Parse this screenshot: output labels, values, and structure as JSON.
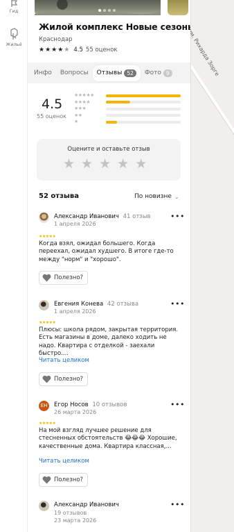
{
  "rail": {
    "items": [
      {
        "label": "Гид"
      },
      {
        "label": "Жильё"
      }
    ]
  },
  "map": {
    "road_label": "им. Рихарда Зорге"
  },
  "place": {
    "title": "Жилой комплекс Новые сезоны",
    "city": "Краснодар",
    "rating": "4.5",
    "ratings_count": "55 оценок"
  },
  "tabs": [
    {
      "label": "Инфо",
      "badge": ""
    },
    {
      "label": "Вопросы",
      "badge": ""
    },
    {
      "label": "Отзывы",
      "badge": "52",
      "active": true
    },
    {
      "label": "Фото",
      "badge": "9"
    }
  ],
  "summary": {
    "score": "4.5",
    "count": "55 оценок",
    "distribution": [
      {
        "stars": "★★★★★",
        "fraction": 1.0
      },
      {
        "stars": "★★★★",
        "fraction": 0.32
      },
      {
        "stars": "★★★",
        "fraction": 0.0
      },
      {
        "stars": "★★",
        "fraction": 0.0
      },
      {
        "stars": "★",
        "fraction": 0.15
      }
    ],
    "accent": "#f5b400"
  },
  "rate_prompt": {
    "title": "Оцените и оставьте отзыв"
  },
  "reviews_head": {
    "count_label": "52 отзыва",
    "sort_label": "По новизне"
  },
  "reviews": [
    {
      "name": "Александр Иванович",
      "reviews_count": "41 отзыв",
      "date": "1 апреля 2026",
      "stars": "★★★★★",
      "text": "Когда взял, ожидал большего. Когда переехал, ожидал худшего. В итоге где-то между \"норм\" и \"хорошо\".",
      "read_more": "",
      "useful": "Полезно?"
    },
    {
      "name": "Евгения Конева",
      "reviews_count": "42 отзыва",
      "date": "1 апреля 2026",
      "stars": "★★★★★",
      "text": "Плюсы: школа рядом, закрытая территория. Есть магазины в доме, далеко ходить не надо. Квартира с отделкой - заехали быстро....",
      "read_more": "Читать целиком",
      "useful": "Полезно?"
    },
    {
      "name": "Егор Носов",
      "initials": "ЕН",
      "reviews_count": "10 отзывов",
      "date": "26 марта 2026",
      "stars": "★★★★★",
      "text": "На мой взгляд лучшее решение для стесненных обстоятельств 😂😂😂 Хорошие, качественные дома. Квартира классная,...",
      "read_more": "Читать целиком",
      "useful": "Полезно?"
    },
    {
      "name": "Александр Иванович",
      "reviews_count": "19 отзывов",
      "date": "23 марта 2026"
    }
  ]
}
